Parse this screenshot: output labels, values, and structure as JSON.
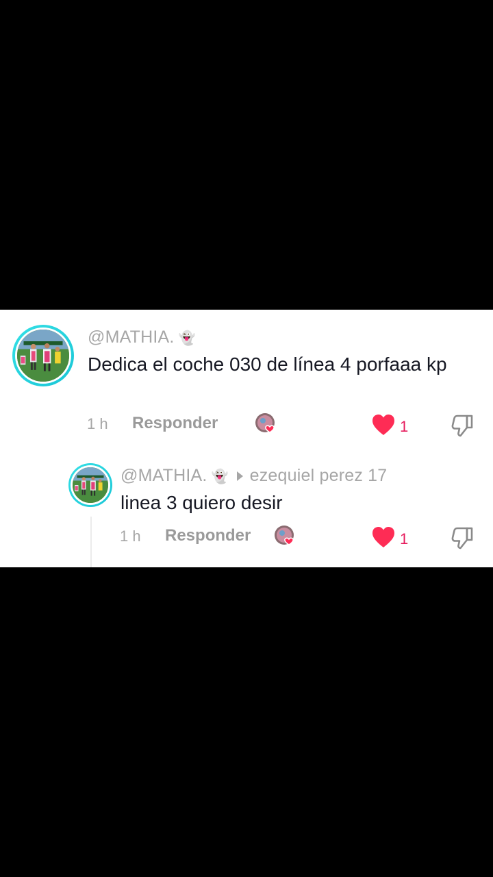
{
  "comment": {
    "username": "@MATHIA.",
    "text": "Dedica el coche 030 de línea 4 porfaaa kp",
    "time": "1 h",
    "reply_label": "Responder",
    "like_count": "1"
  },
  "reply": {
    "username": "@MATHIA.",
    "reply_to": "ezequiel perez 17",
    "text": "linea 3 quiero desir",
    "time": "1 h",
    "reply_label": "Responder",
    "like_count": "1"
  },
  "icons": {
    "ghost": "👻"
  },
  "colors": {
    "like": "#fe2c55",
    "avatar_ring": "#20d5e0"
  }
}
